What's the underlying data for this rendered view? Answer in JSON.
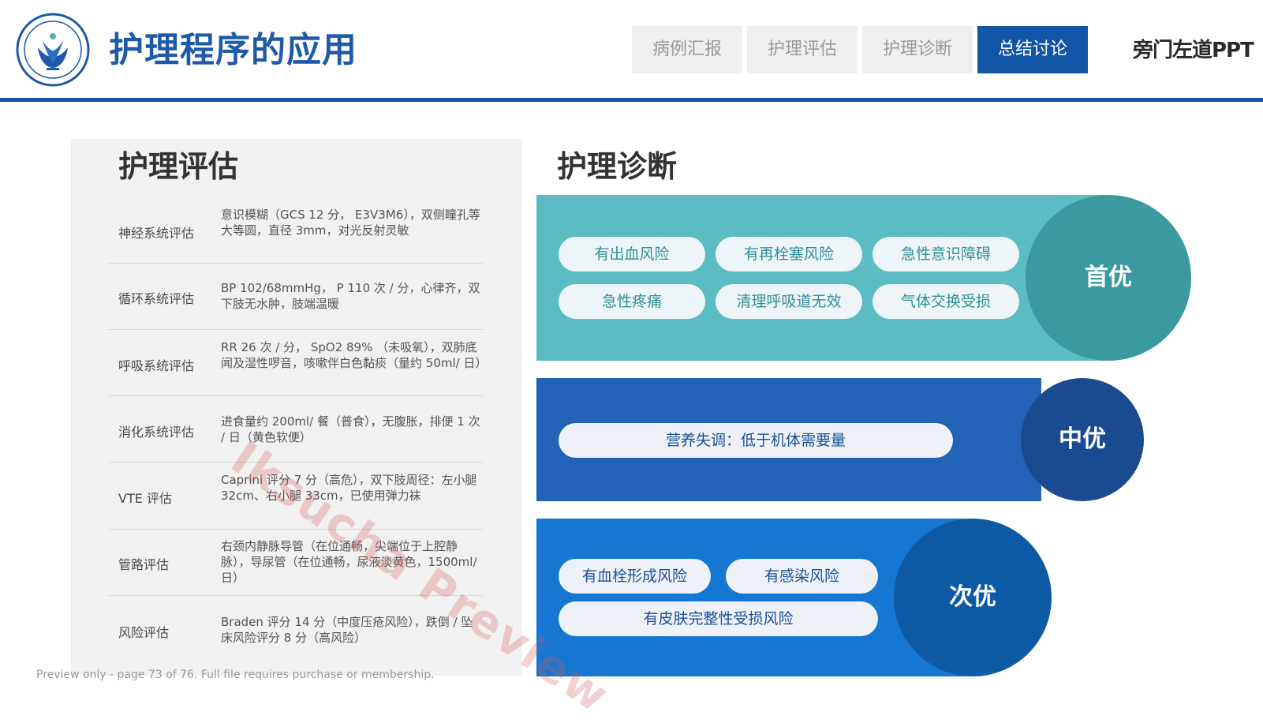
{
  "header": {
    "title": "护理程序的应用",
    "brand": "旁门左道PPT",
    "tabs": [
      {
        "label": "病例汇报",
        "active": false
      },
      {
        "label": "护理评估",
        "active": false
      },
      {
        "label": "护理诊断",
        "active": false
      },
      {
        "label": "总结讨论",
        "active": true
      }
    ],
    "logo_icon": "school-emblem-icon",
    "accent_color": "#1a53a3"
  },
  "assessment": {
    "heading": "护理评估",
    "rows": [
      {
        "label": "神经系统评估",
        "value": "意识模糊（GCS 12 分， E3V3M6），双侧瞳孔等大等圆，直径 3mm，对光反射灵敏"
      },
      {
        "label": "循环系统评估",
        "value": "BP 102/68mmHg， P 110 次 / 分，心律齐，双下肢无水肿，肢端温暖"
      },
      {
        "label": "呼吸系统评估",
        "value": "RR 26 次 / 分， SpO2 89% （未吸氧），双肺底闻及湿性啰音，咳嗽伴白色黏痰（量约 50ml/ 日）"
      },
      {
        "label": "消化系统评估",
        "value": "进食量约 200ml/ 餐（普食），无腹胀，排便 1 次 / 日（黄色软便）"
      },
      {
        "label": "VTE 评估",
        "value": "Caprini 评分 7 分（高危），双下肢周径：左小腿 32cm、右小腿 33cm，已使用弹力袜"
      },
      {
        "label": "管路评估",
        "value": "右颈内静脉导管（在位通畅，尖端位于上腔静脉），导尿管（在位通畅，尿液淡黄色，1500ml/ 日）"
      },
      {
        "label": "风险评估",
        "value": "Braden 评分 14 分（中度压疮风险），跌倒 / 坠床风险评分 8 分（高风险）"
      }
    ]
  },
  "diagnosis": {
    "heading": "护理诊断",
    "first": {
      "label": "首优",
      "color": "#5bbcc4",
      "circle_color": "#3a9aa0",
      "items": [
        "有出血风险",
        "有再栓塞风险",
        "急性意识障碍",
        "急性疼痛",
        "清理呼吸道无效",
        "气体交换受损"
      ]
    },
    "middle": {
      "label": "中优",
      "color": "#2263b8",
      "circle_color": "#1a4b90",
      "items": [
        "营养失调：低于机体需要量"
      ]
    },
    "last": {
      "label": "次优",
      "color": "#1577d2",
      "circle_color": "#0f5aa4",
      "items": [
        "有血栓形成风险",
        "有感染风险",
        "有皮肤完整性受损风险"
      ]
    }
  },
  "watermark": "Iksucha Preview",
  "footer": "Preview only - page 73 of 76. Full file requires purchase or membership."
}
